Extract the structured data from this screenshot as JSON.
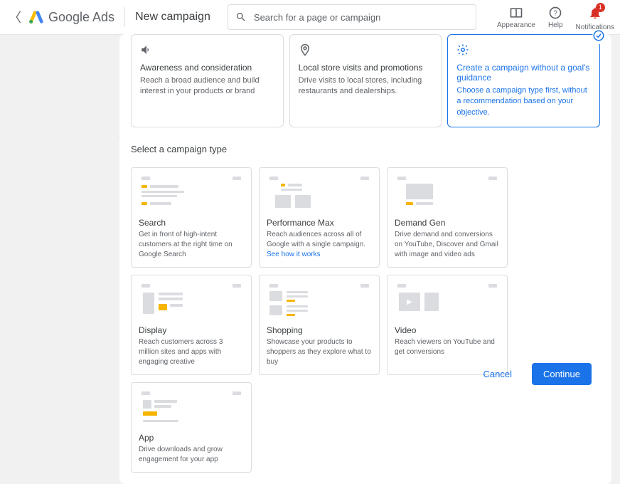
{
  "header": {
    "brand": "Google Ads",
    "page_title": "New campaign",
    "search_placeholder": "Search for a page or campaign",
    "right": {
      "appearance": "Appearance",
      "help": "Help",
      "notifications": "Notifications",
      "notif_count": "1"
    }
  },
  "goals": [
    {
      "icon": "speaker",
      "title": "Awareness and consideration",
      "desc": "Reach a broad audience and build interest in your products or brand",
      "selected": false
    },
    {
      "icon": "pin",
      "title": "Local store visits and promotions",
      "desc": "Drive visits to local stores, including restaurants and dealerships.",
      "selected": false
    },
    {
      "icon": "gear",
      "title": "Create a campaign without a goal's guidance",
      "desc": "Choose a campaign type first, without a recommendation based on your objective.",
      "selected": true
    }
  ],
  "types_section_title": "Select a campaign type",
  "types": [
    {
      "title": "Search",
      "desc": "Get in front of high-intent customers at the right time on Google Search",
      "link": null
    },
    {
      "title": "Performance Max",
      "desc": "Reach audiences across all of Google with a single campaign. ",
      "link": "See how it works"
    },
    {
      "title": "Demand Gen",
      "desc": "Drive demand and conversions on YouTube, Discover and Gmail with image and video ads",
      "link": null
    },
    {
      "title": "Display",
      "desc": "Reach customers across 3 million sites and apps with engaging creative",
      "link": null
    },
    {
      "title": "Shopping",
      "desc": "Showcase your products to shoppers as they explore what to buy",
      "link": null
    },
    {
      "title": "Video",
      "desc": "Reach viewers on YouTube and get conversions",
      "link": null
    },
    {
      "title": "App",
      "desc": "Drive downloads and grow engagement for your app",
      "link": null
    }
  ],
  "footer": {
    "cancel": "Cancel",
    "continue": "Continue"
  }
}
